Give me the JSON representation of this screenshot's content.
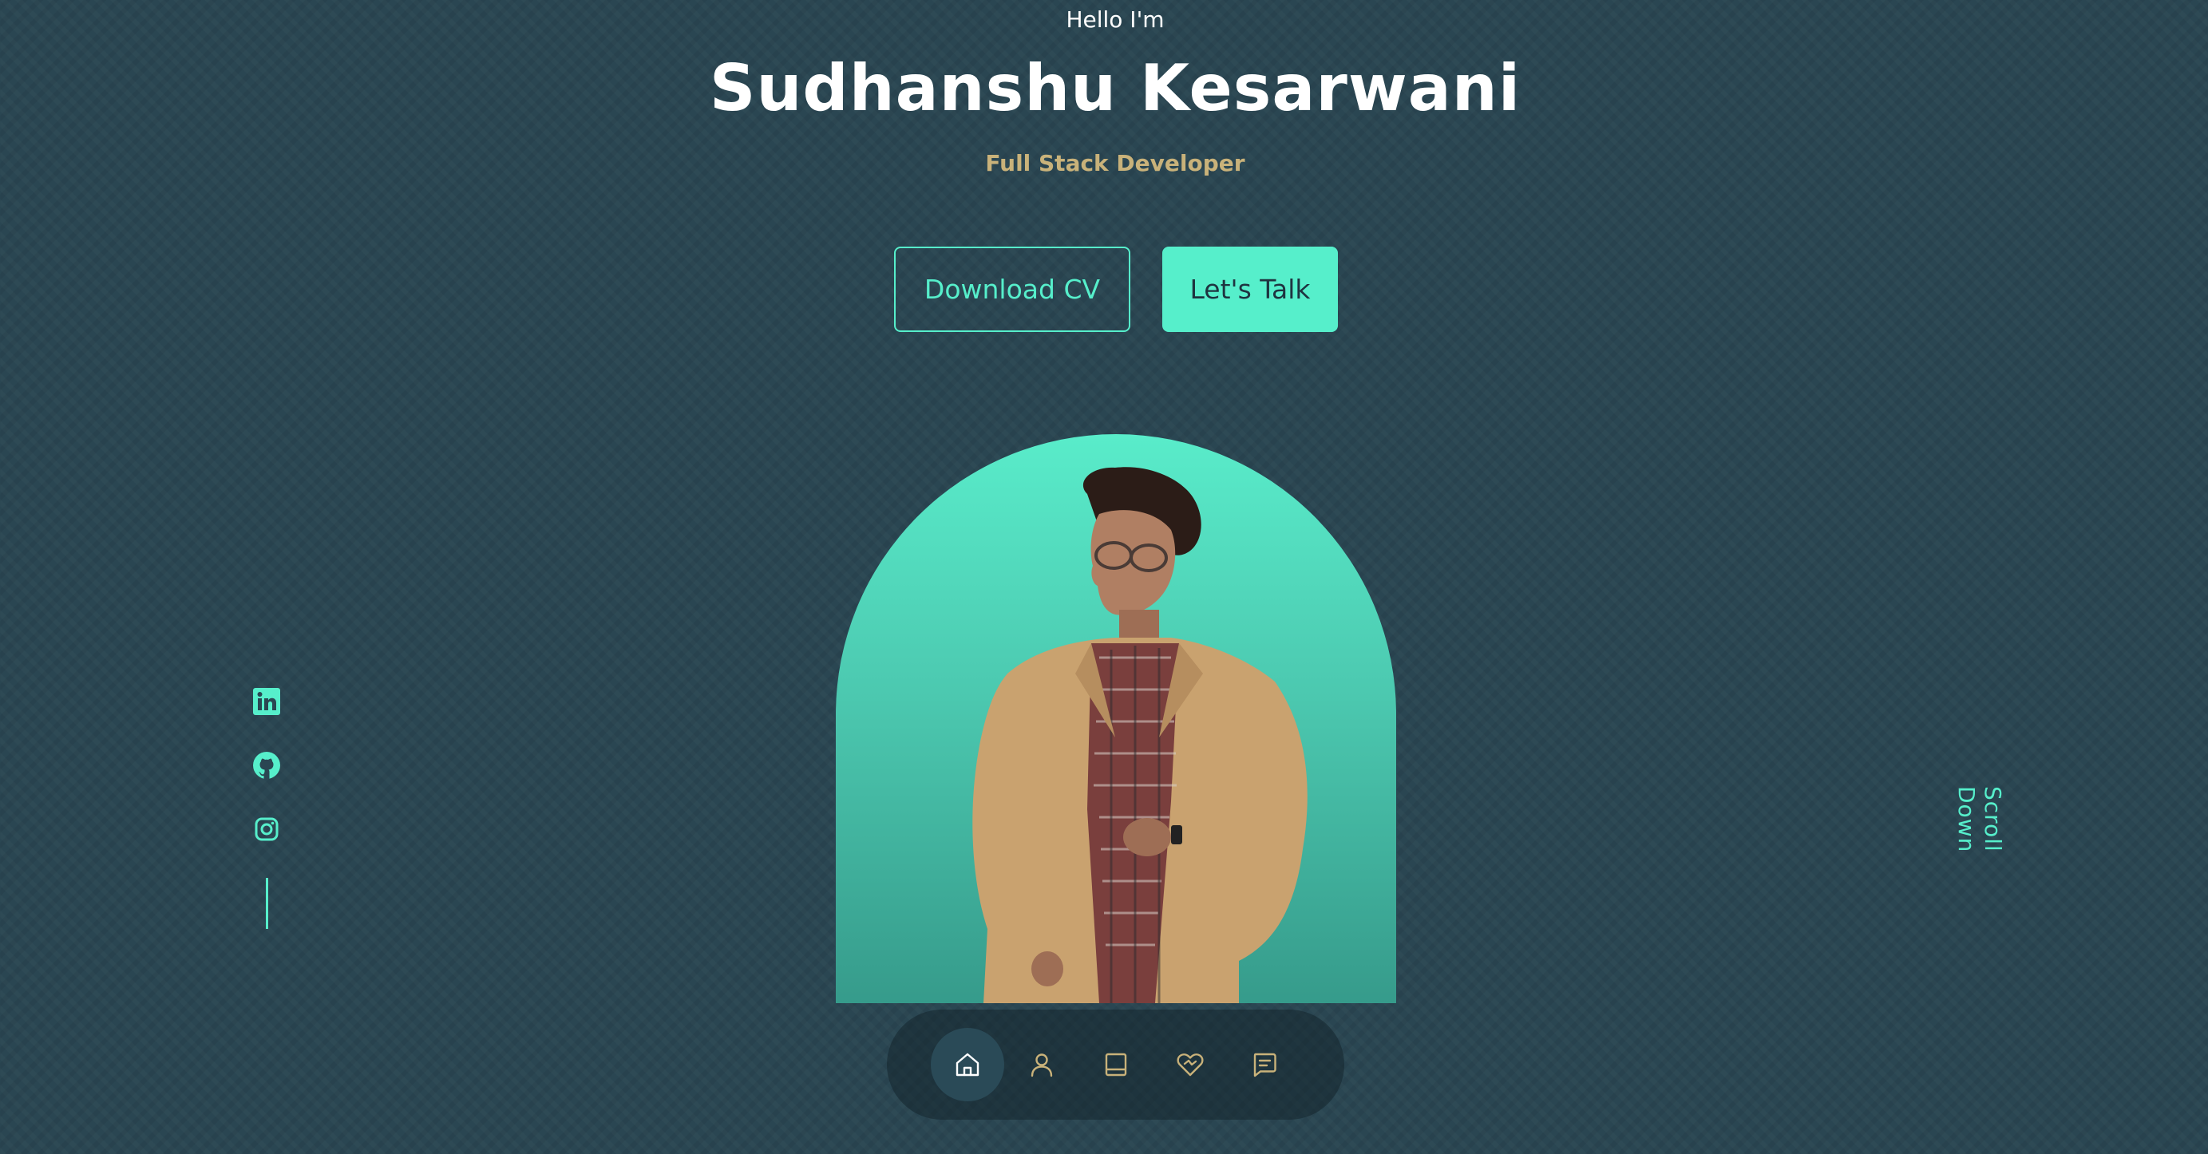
{
  "hero": {
    "greeting": "Hello I'm",
    "name": "Sudhanshu Kesarwani",
    "role": "Full Stack Developer",
    "buttons": {
      "download_cv": "Download CV",
      "lets_talk": "Let's Talk"
    },
    "portrait_alt": "Sudhanshu Kesarwani"
  },
  "socials": [
    {
      "icon": "linkedin-icon"
    },
    {
      "icon": "github-icon"
    },
    {
      "icon": "instagram-icon"
    }
  ],
  "scroll_down": "Scroll Down",
  "nav": {
    "items": [
      {
        "icon": "home-icon",
        "active": true
      },
      {
        "icon": "user-icon",
        "active": false
      },
      {
        "icon": "book-icon",
        "active": false
      },
      {
        "icon": "services-icon",
        "active": false
      },
      {
        "icon": "message-icon",
        "active": false
      }
    ]
  },
  "colors": {
    "background": "#2a4652",
    "accent": "#56efcb",
    "role_text": "#c9b27a",
    "nav_icon": "#c9b27a",
    "nav_active_bg": "#2a4a57"
  }
}
